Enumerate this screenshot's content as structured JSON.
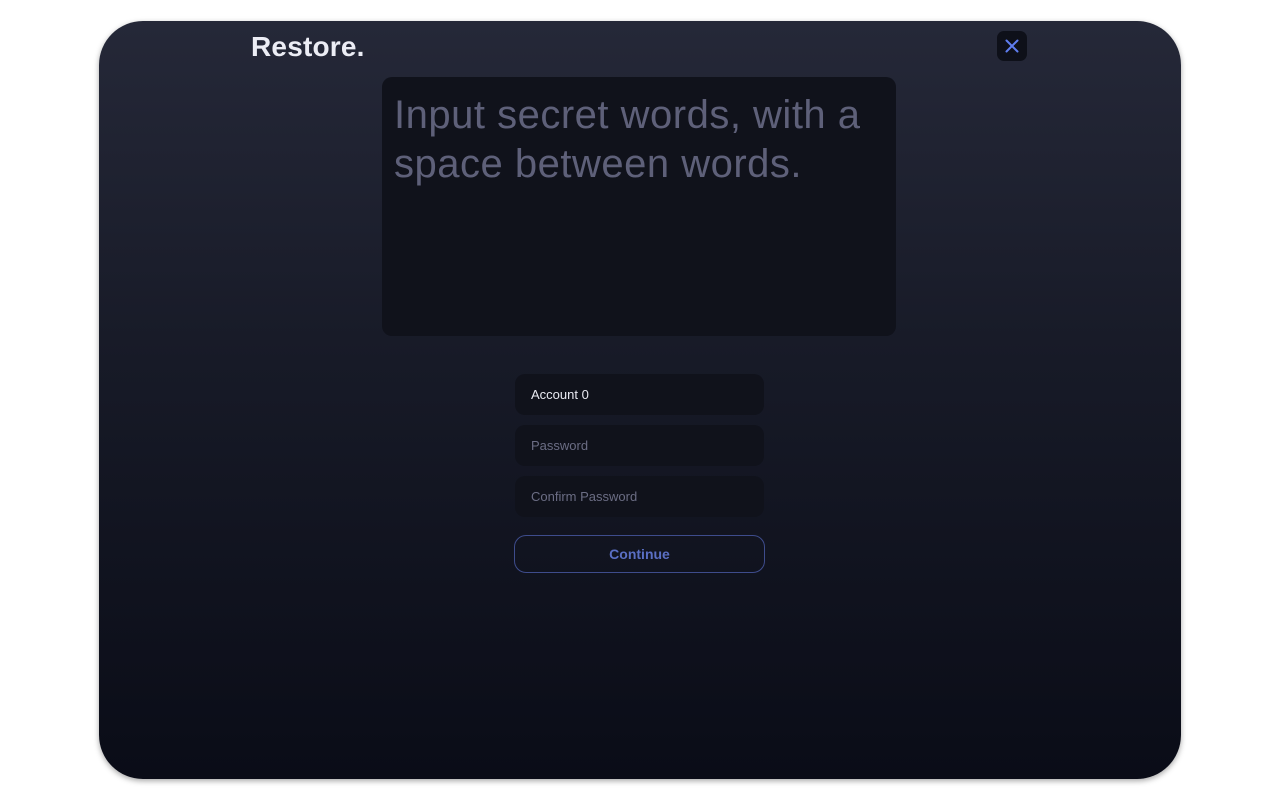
{
  "header": {
    "title": "Restore.",
    "close_icon": "close-icon"
  },
  "secret_words": {
    "placeholder": "Input secret words, with a space between words."
  },
  "form": {
    "account_value": "Account 0",
    "password_placeholder": "Password",
    "confirm_password_placeholder": "Confirm Password"
  },
  "actions": {
    "continue_label": "Continue"
  },
  "colors": {
    "accent": "#5a6fc4",
    "close_icon": "#5f7df0"
  }
}
